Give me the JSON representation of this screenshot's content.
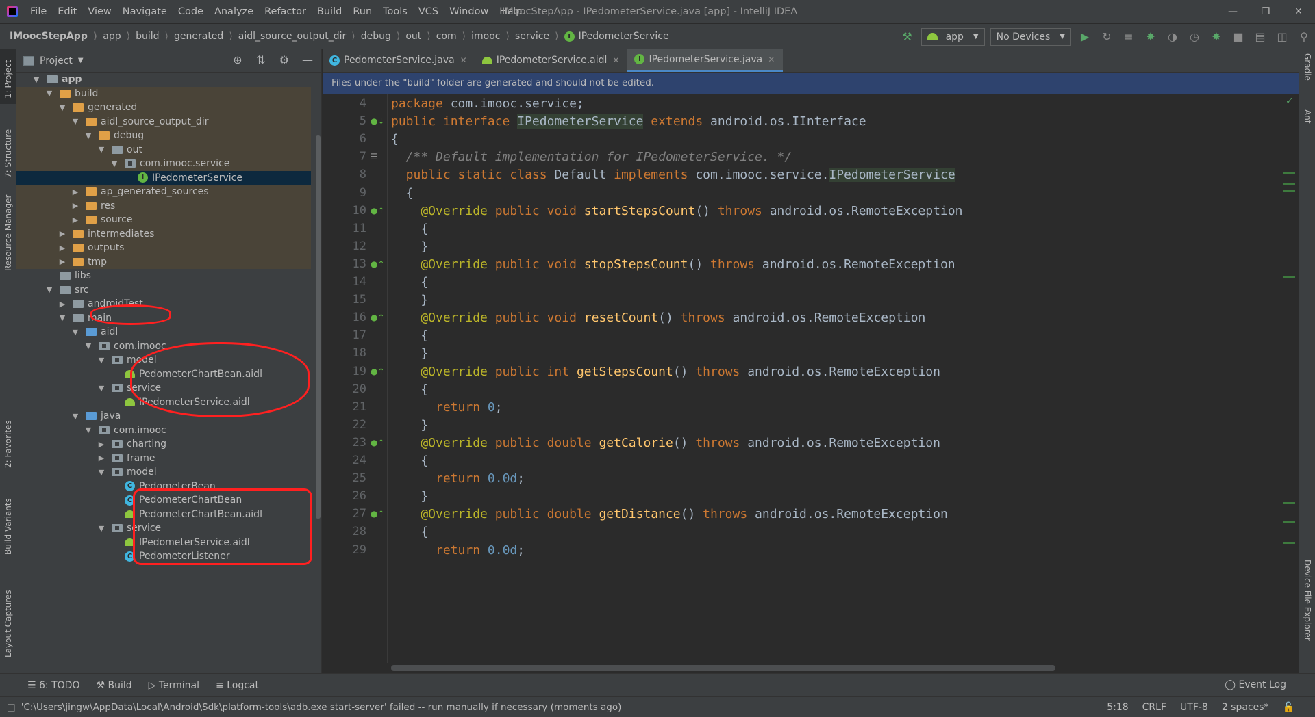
{
  "window": {
    "title": "IMoocStepApp - IPedometerService.java [app] - IntelliJ IDEA",
    "menu": [
      "File",
      "Edit",
      "View",
      "Navigate",
      "Code",
      "Analyze",
      "Refactor",
      "Build",
      "Run",
      "Tools",
      "VCS",
      "Window",
      "Help"
    ]
  },
  "breadcrumbs": [
    "IMoocStepApp",
    "app",
    "build",
    "generated",
    "aidl_source_output_dir",
    "debug",
    "out",
    "com",
    "imooc",
    "service",
    "IPedometerService"
  ],
  "toolbar": {
    "run_config": "app",
    "device": "No Devices"
  },
  "left_stripe": [
    "1: Project",
    "7: Structure",
    "Resource Manager",
    "2: Favorites",
    "Build Variants",
    "Layout Captures"
  ],
  "right_stripe": [
    "Gradle",
    "Ant",
    "Device File Explorer"
  ],
  "project_panel": {
    "title": "Project",
    "tree": [
      {
        "label": "app",
        "depth": 0,
        "icon": "folder-grey",
        "toggle": "open",
        "bold": true
      },
      {
        "label": "build",
        "depth": 1,
        "icon": "folder-orange",
        "toggle": "open",
        "gen": true
      },
      {
        "label": "generated",
        "depth": 2,
        "icon": "folder-orange",
        "toggle": "open",
        "gen": true
      },
      {
        "label": "aidl_source_output_dir",
        "depth": 3,
        "icon": "folder-orange",
        "toggle": "open",
        "gen": true
      },
      {
        "label": "debug",
        "depth": 4,
        "icon": "folder-orange",
        "toggle": "open",
        "gen": true
      },
      {
        "label": "out",
        "depth": 5,
        "icon": "folder-grey",
        "toggle": "open",
        "gen": true
      },
      {
        "label": "com.imooc.service",
        "depth": 6,
        "icon": "package",
        "toggle": "open",
        "gen": true
      },
      {
        "label": "IPedometerService",
        "depth": 7,
        "icon": "interface",
        "toggle": "none",
        "selected": true
      },
      {
        "label": "ap_generated_sources",
        "depth": 3,
        "icon": "folder-orange",
        "toggle": "closed",
        "gen": true
      },
      {
        "label": "res",
        "depth": 3,
        "icon": "folder-orange",
        "toggle": "closed",
        "gen": true
      },
      {
        "label": "source",
        "depth": 3,
        "icon": "folder-orange",
        "toggle": "closed",
        "gen": true
      },
      {
        "label": "intermediates",
        "depth": 2,
        "icon": "folder-orange",
        "toggle": "closed",
        "gen": true
      },
      {
        "label": "outputs",
        "depth": 2,
        "icon": "folder-orange",
        "toggle": "closed",
        "gen": true
      },
      {
        "label": "tmp",
        "depth": 2,
        "icon": "folder-orange",
        "toggle": "closed",
        "gen": true
      },
      {
        "label": "libs",
        "depth": 1,
        "icon": "folder-grey",
        "toggle": "none"
      },
      {
        "label": "src",
        "depth": 1,
        "icon": "folder-grey",
        "toggle": "open"
      },
      {
        "label": "androidTest",
        "depth": 2,
        "icon": "folder-grey",
        "toggle": "closed"
      },
      {
        "label": "main",
        "depth": 2,
        "icon": "folder-grey",
        "toggle": "open"
      },
      {
        "label": "aidl",
        "depth": 3,
        "icon": "folder-blue",
        "toggle": "open"
      },
      {
        "label": "com.imooc",
        "depth": 4,
        "icon": "package",
        "toggle": "open"
      },
      {
        "label": "model",
        "depth": 5,
        "icon": "package",
        "toggle": "open"
      },
      {
        "label": "PedometerChartBean.aidl",
        "depth": 6,
        "icon": "android",
        "toggle": "none"
      },
      {
        "label": "service",
        "depth": 5,
        "icon": "package",
        "toggle": "open"
      },
      {
        "label": "IPedometerService.aidl",
        "depth": 6,
        "icon": "android",
        "toggle": "none"
      },
      {
        "label": "java",
        "depth": 3,
        "icon": "folder-blue",
        "toggle": "open"
      },
      {
        "label": "com.imooc",
        "depth": 4,
        "icon": "package",
        "toggle": "open"
      },
      {
        "label": "charting",
        "depth": 5,
        "icon": "package",
        "toggle": "closed"
      },
      {
        "label": "frame",
        "depth": 5,
        "icon": "package",
        "toggle": "closed"
      },
      {
        "label": "model",
        "depth": 5,
        "icon": "package",
        "toggle": "open"
      },
      {
        "label": "PedometerBean",
        "depth": 6,
        "icon": "class",
        "toggle": "none"
      },
      {
        "label": "PedometerChartBean",
        "depth": 6,
        "icon": "class",
        "toggle": "none"
      },
      {
        "label": "PedometerChartBean.aidl",
        "depth": 6,
        "icon": "android",
        "toggle": "none"
      },
      {
        "label": "service",
        "depth": 5,
        "icon": "package",
        "toggle": "open"
      },
      {
        "label": "IPedometerService.aidl",
        "depth": 6,
        "icon": "android",
        "toggle": "none"
      },
      {
        "label": "PedometerListener",
        "depth": 6,
        "icon": "class",
        "toggle": "none"
      }
    ]
  },
  "editor": {
    "tabs": [
      {
        "label": "PedometerService.java",
        "icon": "class",
        "active": false
      },
      {
        "label": "IPedometerService.aidl",
        "icon": "android",
        "active": false
      },
      {
        "label": "IPedometerService.java",
        "icon": "interface",
        "active": true
      }
    ],
    "banner": "Files under the \"build\" folder are generated and should not be edited.",
    "lines": [
      {
        "n": "4",
        "mark": "",
        "tokens": [
          [
            "kw",
            "package"
          ],
          [
            "cls",
            " com.imooc.service;"
          ]
        ]
      },
      {
        "n": "5",
        "mark": "impl",
        "tokens": [
          [
            "kw",
            "public interface "
          ],
          [
            "hlcls",
            "IPedometerService"
          ],
          [
            "kw",
            " extends "
          ],
          [
            "cls",
            "android.os.IInterface"
          ]
        ]
      },
      {
        "n": "6",
        "mark": "",
        "tokens": [
          [
            "cls",
            "{"
          ]
        ]
      },
      {
        "n": "7",
        "mark": "doc",
        "tokens": [
          [
            "cm",
            "  /** Default implementation for IPedometerService. */"
          ]
        ]
      },
      {
        "n": "8",
        "mark": "",
        "tokens": [
          [
            "kw",
            "  public static class "
          ],
          [
            "cls",
            "Default "
          ],
          [
            "kw",
            "implements "
          ],
          [
            "cls",
            "com.imooc.service."
          ],
          [
            "hlcls",
            "IPedometerService"
          ]
        ]
      },
      {
        "n": "9",
        "mark": "",
        "tokens": [
          [
            "cls",
            "  {"
          ]
        ]
      },
      {
        "n": "10",
        "mark": "override",
        "tokens": [
          [
            "an",
            "    @Override "
          ],
          [
            "kw",
            "public void "
          ],
          [
            "fn",
            "startStepsCount"
          ],
          [
            "cls",
            "() "
          ],
          [
            "kw",
            "throws "
          ],
          [
            "cls",
            "android.os.RemoteException"
          ]
        ]
      },
      {
        "n": "11",
        "mark": "",
        "tokens": [
          [
            "cls",
            "    {"
          ]
        ]
      },
      {
        "n": "12",
        "mark": "",
        "tokens": [
          [
            "cls",
            "    }"
          ]
        ]
      },
      {
        "n": "13",
        "mark": "override",
        "tokens": [
          [
            "an",
            "    @Override "
          ],
          [
            "kw",
            "public void "
          ],
          [
            "fn",
            "stopStepsCount"
          ],
          [
            "cls",
            "() "
          ],
          [
            "kw",
            "throws "
          ],
          [
            "cls",
            "android.os.RemoteException"
          ]
        ]
      },
      {
        "n": "14",
        "mark": "",
        "tokens": [
          [
            "cls",
            "    {"
          ]
        ]
      },
      {
        "n": "15",
        "mark": "",
        "tokens": [
          [
            "cls",
            "    }"
          ]
        ]
      },
      {
        "n": "16",
        "mark": "override",
        "tokens": [
          [
            "an",
            "    @Override "
          ],
          [
            "kw",
            "public void "
          ],
          [
            "fn",
            "resetCount"
          ],
          [
            "cls",
            "() "
          ],
          [
            "kw",
            "throws "
          ],
          [
            "cls",
            "android.os.RemoteException"
          ]
        ]
      },
      {
        "n": "17",
        "mark": "",
        "tokens": [
          [
            "cls",
            "    {"
          ]
        ]
      },
      {
        "n": "18",
        "mark": "",
        "tokens": [
          [
            "cls",
            "    }"
          ]
        ]
      },
      {
        "n": "19",
        "mark": "override",
        "tokens": [
          [
            "an",
            "    @Override "
          ],
          [
            "kw",
            "public int "
          ],
          [
            "fn",
            "getStepsCount"
          ],
          [
            "cls",
            "() "
          ],
          [
            "kw",
            "throws "
          ],
          [
            "cls",
            "android.os.RemoteException"
          ]
        ]
      },
      {
        "n": "20",
        "mark": "",
        "tokens": [
          [
            "cls",
            "    {"
          ]
        ]
      },
      {
        "n": "21",
        "mark": "",
        "tokens": [
          [
            "kw",
            "      return "
          ],
          [
            "num",
            "0"
          ],
          [
            "cls",
            ";"
          ]
        ]
      },
      {
        "n": "22",
        "mark": "",
        "tokens": [
          [
            "cls",
            "    }"
          ]
        ]
      },
      {
        "n": "23",
        "mark": "override",
        "tokens": [
          [
            "an",
            "    @Override "
          ],
          [
            "kw",
            "public double "
          ],
          [
            "fn",
            "getCalorie"
          ],
          [
            "cls",
            "() "
          ],
          [
            "kw",
            "throws "
          ],
          [
            "cls",
            "android.os.RemoteException"
          ]
        ]
      },
      {
        "n": "24",
        "mark": "",
        "tokens": [
          [
            "cls",
            "    {"
          ]
        ]
      },
      {
        "n": "25",
        "mark": "",
        "tokens": [
          [
            "kw",
            "      return "
          ],
          [
            "num",
            "0.0d"
          ],
          [
            "cls",
            ";"
          ]
        ]
      },
      {
        "n": "26",
        "mark": "",
        "tokens": [
          [
            "cls",
            "    }"
          ]
        ]
      },
      {
        "n": "27",
        "mark": "override",
        "tokens": [
          [
            "an",
            "    @Override "
          ],
          [
            "kw",
            "public double "
          ],
          [
            "fn",
            "getDistance"
          ],
          [
            "cls",
            "() "
          ],
          [
            "kw",
            "throws "
          ],
          [
            "cls",
            "android.os.RemoteException"
          ]
        ]
      },
      {
        "n": "28",
        "mark": "",
        "tokens": [
          [
            "cls",
            "    {"
          ]
        ]
      },
      {
        "n": "29",
        "mark": "",
        "tokens": [
          [
            "kw",
            "      return "
          ],
          [
            "num",
            "0.0d"
          ],
          [
            "cls",
            ";"
          ]
        ]
      }
    ]
  },
  "bottom_tools": [
    "6: TODO",
    "Build",
    "Terminal",
    "Logcat"
  ],
  "event_log": "Event Log",
  "status": {
    "message": "'C:\\Users\\jingw\\AppData\\Local\\Android\\Sdk\\platform-tools\\adb.exe start-server' failed -- run manually if necessary (moments ago)",
    "position": "5:18",
    "line_sep": "CRLF",
    "encoding": "UTF-8",
    "indent": "2 spaces*"
  },
  "colors": {
    "keyword": "#cc7832",
    "annotation": "#bbb529",
    "method": "#ffc66d",
    "number": "#6897bb",
    "comment": "#808080",
    "banner": "#2e436e",
    "annotation_ink": "#ff2020"
  }
}
